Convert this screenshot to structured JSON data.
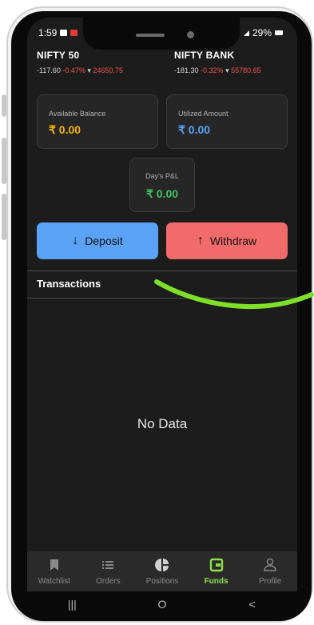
{
  "status_bar": {
    "time": "1:59",
    "battery": "29%"
  },
  "indices": [
    {
      "name": "NIFTY 50",
      "change": "-117.60",
      "percent": "-0.47%",
      "arrow": "▾",
      "value": "24650.75"
    },
    {
      "name": "NIFTY BANK",
      "change": "-181.30",
      "percent": "-0.32%",
      "arrow": "▾",
      "value": "55780.65"
    }
  ],
  "cards": {
    "available": {
      "label": "Available Balance",
      "value": "₹ 0.00",
      "color": "#f5b300"
    },
    "utilized": {
      "label": "Utilized Amount",
      "value": "₹ 0.00",
      "color": "#5aa2f5"
    },
    "pnl": {
      "label": "Day's P&L",
      "value": "₹ 0.00",
      "color": "#43c463"
    }
  },
  "buttons": {
    "deposit": {
      "label": "Deposit",
      "arrow": "↓",
      "color": "#5aa2f5"
    },
    "withdraw": {
      "label": "Withdraw",
      "arrow": "↑",
      "color": "#f26b6b"
    }
  },
  "transactions": {
    "title": "Transactions",
    "empty_text": "No Data"
  },
  "tabs": [
    {
      "label": "Watchlist",
      "icon": "bookmark-icon",
      "active": false
    },
    {
      "label": "Orders",
      "icon": "list-icon",
      "active": false
    },
    {
      "label": "Positions",
      "icon": "pie-chart-icon",
      "active": false
    },
    {
      "label": "Funds",
      "icon": "wallet-icon",
      "active": true
    },
    {
      "label": "Profile",
      "icon": "user-icon",
      "active": false
    }
  ],
  "nav": {
    "recents": "|||",
    "home": "O",
    "back": "<"
  },
  "accent_color": "#8ee04a"
}
